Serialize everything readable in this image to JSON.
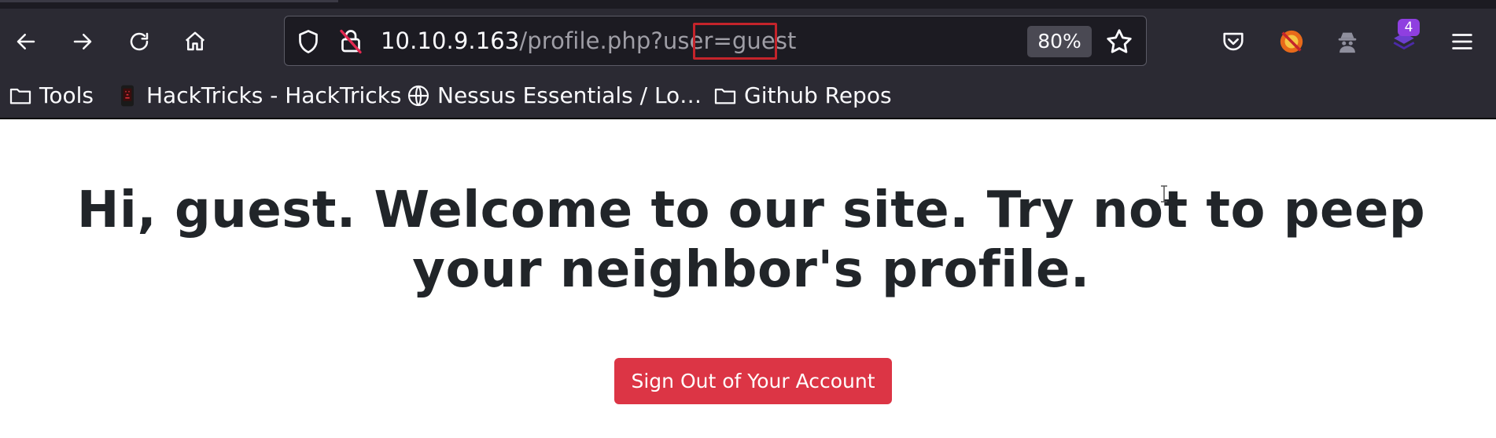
{
  "browser": {
    "address_bar": {
      "host": "10.10.9.163",
      "path": "/profile.php?user=guest",
      "zoom": "80%"
    },
    "toolbar_icons": [
      "back-icon",
      "forward-icon",
      "reload-icon",
      "home-icon",
      "shield-icon",
      "insecure-lock-icon",
      "star-icon",
      "pocket-icon",
      "extension-icon",
      "spy-icon",
      "stack-icon",
      "menu-icon"
    ],
    "extension_badge": "4",
    "bookmarks": [
      {
        "label": "Tools",
        "icon": "folder-icon"
      },
      {
        "label": "HackTricks - HackTricks",
        "icon": "hacktricks-icon"
      },
      {
        "label": "Nessus Essentials / Lo…",
        "icon": "globe-icon"
      },
      {
        "label": "Github Repos",
        "icon": "folder-icon"
      }
    ]
  },
  "page": {
    "greeting_prefix": "Hi, ",
    "username": "guest",
    "greeting_suffix": ". Welcome to our site. Try not to peep your neighbor's profile.",
    "signout_label": "Sign Out of Your Account"
  },
  "colors": {
    "toolbar_bg": "#2b2a33",
    "urlbar_bg": "#1c1b22",
    "highlight_box": "#c4242b",
    "button_danger": "#dc3545",
    "text_dark": "#212529",
    "badge": "#8f3fe0"
  }
}
